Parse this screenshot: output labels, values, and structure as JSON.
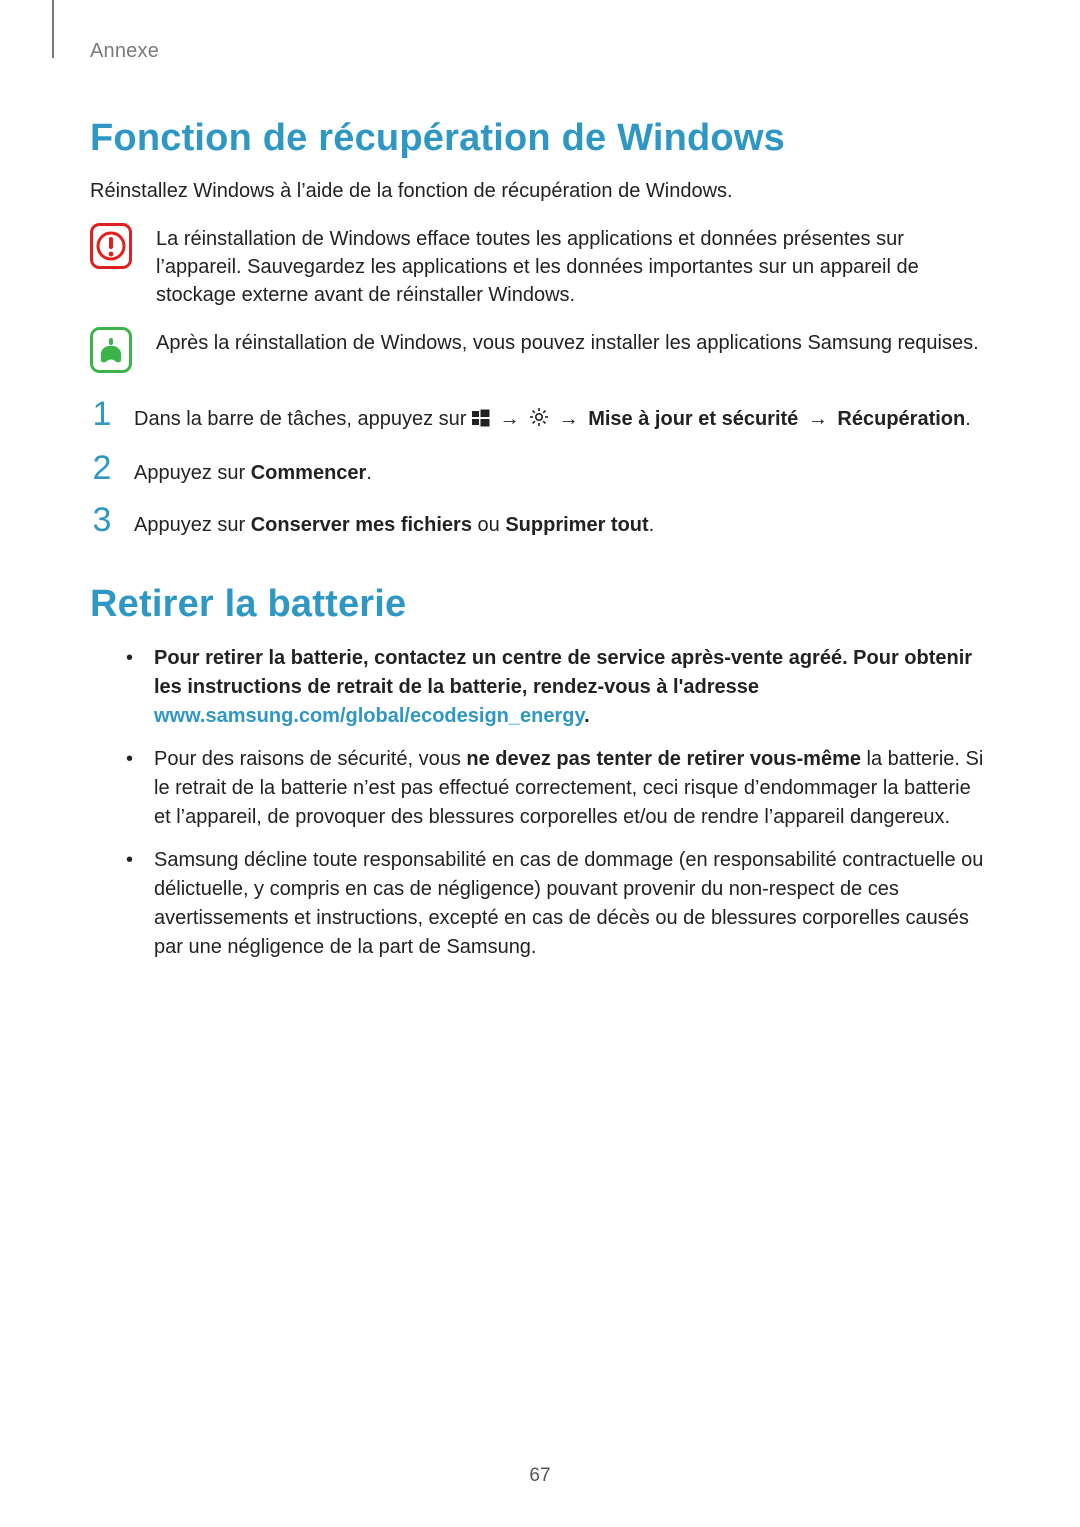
{
  "breadcrumb": "Annexe",
  "section1": {
    "title": "Fonction de récupération de Windows",
    "lead": "Réinstallez Windows à l’aide de la fonction de récupération de Windows.",
    "warning": "La réinstallation de Windows efface toutes les applications et données présentes sur l’appareil. Sauvegardez les applications et les données importantes sur un appareil de stockage externe avant de réinstaller Windows.",
    "info": "Après la réinstallation de Windows, vous pouvez installer les applications Samsung requises.",
    "step1_a": "Dans la barre de tâches, appuyez sur ",
    "arrow1": " → ",
    "arrow2": " → ",
    "step1_b": "Mise à jour et sécurité",
    "arrow3": " → ",
    "step1_c": "Récupération",
    "step1_end": ".",
    "step2_a": "Appuyez sur ",
    "step2_b": "Commencer",
    "step2_end": ".",
    "step3_a": "Appuyez sur ",
    "step3_b": "Conserver mes fichiers",
    "step3_c": " ou ",
    "step3_d": "Supprimer tout",
    "step3_end": "."
  },
  "section2": {
    "title": "Retirer la batterie",
    "b1_a": "Pour retirer la batterie, contactez un centre de service après-vente agréé. Pour obtenir les instructions de retrait de la batterie, rendez-vous à l'adresse ",
    "b1_link": "www.samsung.com/global/ecodesign_energy",
    "b1_end": ".",
    "b2_a": "Pour des raisons de sécurité, vous ",
    "b2_bold": "ne devez pas tenter de retirer vous-même",
    "b2_b": " la batterie. Si le retrait de la batterie n’est pas effectué correctement, ceci risque d’endommager la batterie et l’appareil, de provoquer des blessures corporelles et/ou de rendre l’appareil dangereux.",
    "b3": "Samsung décline toute responsabilité en cas de dommage (en responsabilité contractuelle ou délictuelle, y compris en cas de négligence) pouvant provenir du non-respect de ces avertissements et instructions, excepté en cas de décès ou de blessures corporelles causés par une négligence de la part de Samsung."
  },
  "page_number": "67"
}
